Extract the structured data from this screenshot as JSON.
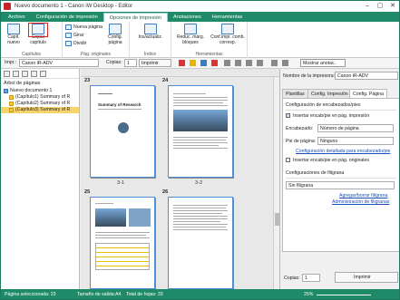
{
  "window": {
    "title": "Nuevo documento 1 - Canon iW Desktop - Editor",
    "controls": [
      "–",
      "▢",
      "✕"
    ]
  },
  "ribbon_tabs": [
    "Archivo",
    "Configuración de impresión",
    "Opciones de impresión",
    "Anotaciones",
    "Herramientas"
  ],
  "ribbon": {
    "chapter_new": "Capít. nuevo",
    "chapter_copy": "Copiar capítulo",
    "new_page": "Nueva página",
    "rotate": "Girar",
    "split": "Dividir",
    "page_config": "Config. página",
    "index_insert": "Ins/actualiz.",
    "reduce_border": "Reduc. márg. bloques",
    "config_print": "Conf.impr. comb. corresp.",
    "group_chapters": "Capítulos",
    "group_pages": "Pág. originales",
    "group_index": "Índice",
    "group_tools": "Herramientas"
  },
  "toolbar": {
    "printer_label": "Impr.:",
    "printer_value": "Canon iR-ADV",
    "copies_label": "Copias:",
    "copies_value": "1",
    "print_button": "Imprimir",
    "show_annotations": "Mostrar anotac."
  },
  "left_pane": {
    "title": "Árbol de páginas",
    "items": [
      "Nuevo documento 1",
      "(Capítulo1) Summary of R",
      "(Capítulo2) Summary of R",
      "(Capítulo3) Summary of R"
    ]
  },
  "center": {
    "page_numbers": [
      "23",
      "24",
      "25",
      "26"
    ],
    "captions": [
      "3-1",
      "3-2"
    ],
    "page1_title": "Summary of Research"
  },
  "right_pane": {
    "printer_name_label": "Nombre de la impresora:",
    "printer_name_value": "Canon iR-ADV",
    "tabs": [
      "Plantillas",
      "Config. Impresión",
      "Config. Página"
    ],
    "header_footer_title": "Configuración de encabezados/pies",
    "insert_header_footer": "Insertar encab/pie en pág. impresión",
    "header_label": "Encabezado:",
    "header_value": "Número de página",
    "footer_label": "Pie de página:",
    "footer_value": "Ninguno",
    "detailed_link": "Configuración detallada para encabezado/pie",
    "insert_original": "Insertar encab/pie en pág. originales",
    "watermark_title": "Configuraciones de filigrana",
    "watermark_value": "Sin filigrana",
    "add_watermark_link": "Agregar/borrar filigrana",
    "manage_watermark_link": "Administración de filigranas",
    "copies_label": "Copias:",
    "copies_value": "1",
    "print_button": "Imprimir"
  },
  "status": {
    "selected_pages": "Página seleccionada: 23",
    "output_size": "Tamaño de salida:A4",
    "total_sheets": "Total de hojas: 33",
    "zoom": "25%"
  },
  "colors": {
    "accent": "#1f8a68",
    "highlight": "#e02020",
    "selection": "#f7d36b"
  }
}
